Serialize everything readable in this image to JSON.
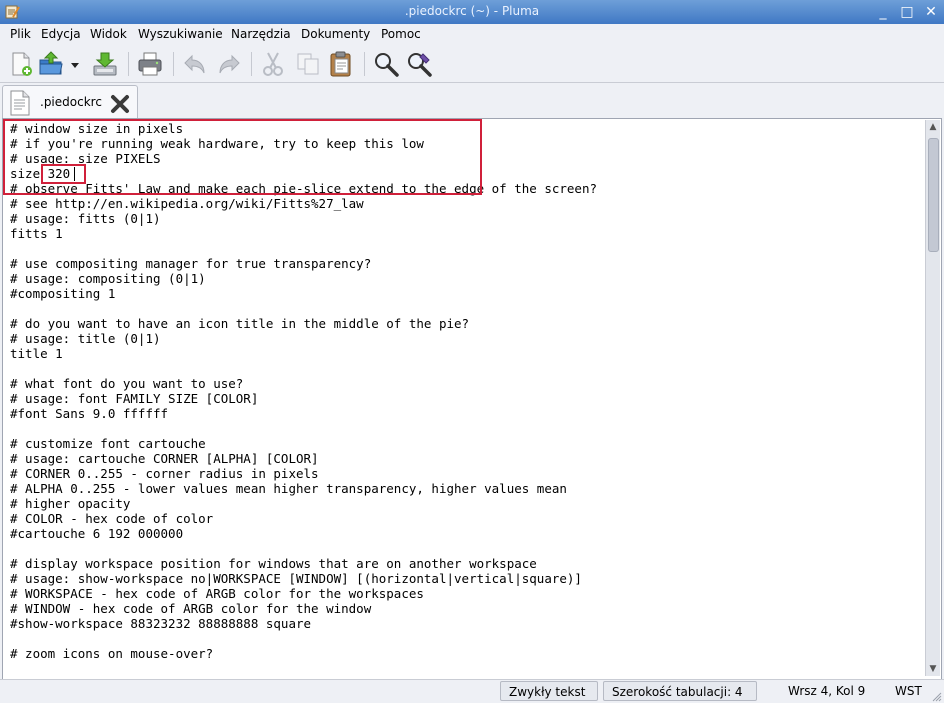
{
  "window": {
    "title": ".piedockrc (~) - Pluma",
    "controls": {
      "minimize": "_",
      "maximize": "□",
      "close": "✕"
    }
  },
  "menu": [
    "Plik",
    "Edycja",
    "Widok",
    "Wyszukiwanie",
    "Narzędzia",
    "Dokumenty",
    "Pomoc"
  ],
  "toolbar": {
    "icons": [
      "new-document-icon",
      "open-icon",
      "open-dropdown-icon",
      "save-icon",
      "print-icon",
      "undo-icon",
      "redo-icon",
      "cut-icon",
      "copy-icon",
      "paste-icon",
      "find-icon",
      "find-replace-icon"
    ]
  },
  "tab": {
    "label": ".piedockrc"
  },
  "editor": {
    "lines": [
      "# window size in pixels",
      "# if you're running weak hardware, try to keep this low",
      "# usage: size PIXELS",
      "size 320",
      "# observe Fitts' Law and make each pie-slice extend to the edge of the screen?",
      "# see http://en.wikipedia.org/wiki/Fitts%27_law",
      "# usage: fitts (0|1)",
      "fitts 1",
      "",
      "# use compositing manager for true transparency?",
      "# usage: compositing (0|1)",
      "#compositing 1",
      "",
      "# do you want to have an icon title in the middle of the pie?",
      "# usage: title (0|1)",
      "title 1",
      "",
      "# what font do you want to use?",
      "# usage: font FAMILY SIZE [COLOR]",
      "#font Sans 9.0 ffffff",
      "",
      "# customize font cartouche",
      "# usage: cartouche CORNER [ALPHA] [COLOR]",
      "# CORNER 0..255 - corner radius in pixels",
      "# ALPHA 0..255 - lower values mean higher transparency, higher values mean",
      "# higher opacity",
      "# COLOR - hex code of color",
      "#cartouche 6 192 000000",
      "",
      "# display workspace position for windows that are on another workspace",
      "# usage: show-workspace no|WORKSPACE [WINDOW] [(horizontal|vertical|square)]",
      "# WORKSPACE - hex code of ARGB color for the workspaces",
      "# WINDOW - hex code of ARGB color for the window",
      "#show-workspace 88323232 88888888 square",
      "",
      "# zoom icons on mouse-over?"
    ],
    "highlight_color": "#d0203a"
  },
  "status": {
    "syntax": "Zwykły tekst",
    "tab_width": "Szerokość tabulacji: 4",
    "position": "Wrsz 4, Kol 9",
    "mode": "WST"
  }
}
